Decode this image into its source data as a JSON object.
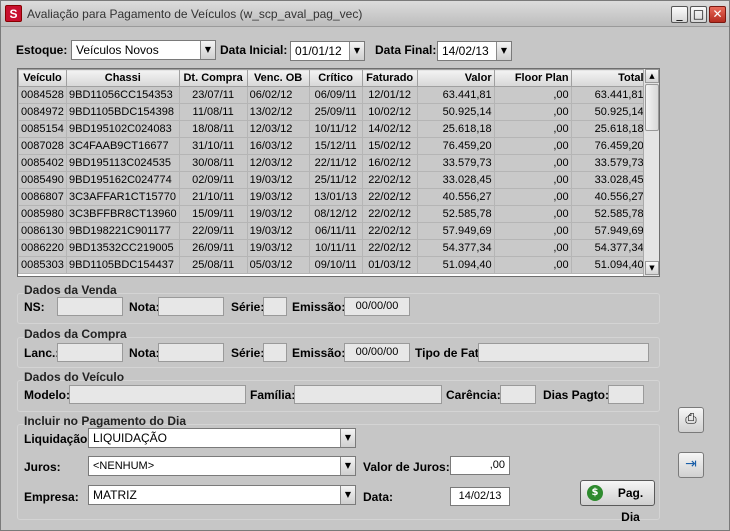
{
  "window": {
    "title": "Avaliação para Pagamento de Veículos (w_scp_aval_pag_vec)",
    "app_icon": "S"
  },
  "filters": {
    "estoque_label": "Estoque:",
    "estoque_value": "Veículos Novos",
    "data_inicial_label": "Data Inicial:",
    "data_inicial_value": "01/01/12",
    "data_final_label": "Data Final:",
    "data_final_value": "14/02/13"
  },
  "grid": {
    "columns": [
      "Veículo",
      "Chassi",
      "Dt. Compra",
      "Venc. OB",
      "Crítico",
      "Faturado",
      "Valor",
      "Floor Plan",
      "Total"
    ],
    "rows": [
      [
        "0084528",
        "9BD11056CC154353",
        "23/07/11",
        "06/02/12",
        "06/09/11",
        "12/01/12",
        "63.441,81",
        ",00",
        "63.441,81"
      ],
      [
        "0084972",
        "9BD1105BDC154398",
        "11/08/11",
        "13/02/12",
        "25/09/11",
        "10/02/12",
        "50.925,14",
        ",00",
        "50.925,14"
      ],
      [
        "0085154",
        "9BD195102C024083",
        "18/08/11",
        "12/03/12",
        "10/11/12",
        "14/02/12",
        "25.618,18",
        ",00",
        "25.618,18"
      ],
      [
        "0087028",
        "3C4FAAB9CT16677",
        "31/10/11",
        "16/03/12",
        "15/12/11",
        "15/02/12",
        "76.459,20",
        ",00",
        "76.459,20"
      ],
      [
        "0085402",
        "9BD195113C024535",
        "30/08/11",
        "12/03/12",
        "22/11/12",
        "16/02/12",
        "33.579,73",
        ",00",
        "33.579,73"
      ],
      [
        "0085490",
        "9BD195162C024774",
        "02/09/11",
        "19/03/12",
        "25/11/12",
        "22/02/12",
        "33.028,45",
        ",00",
        "33.028,45"
      ],
      [
        "0086807",
        "3C3AFFAR1CT15770",
        "21/10/11",
        "19/03/12",
        "13/01/13",
        "22/02/12",
        "40.556,27",
        ",00",
        "40.556,27"
      ],
      [
        "0085980",
        "3C3BFFBR8CT13960",
        "15/09/11",
        "19/03/12",
        "08/12/12",
        "22/02/12",
        "52.585,78",
        ",00",
        "52.585,78"
      ],
      [
        "0086130",
        "9BD198221C901177",
        "22/09/11",
        "19/03/12",
        "06/11/11",
        "22/02/12",
        "57.949,69",
        ",00",
        "57.949,69"
      ],
      [
        "0086220",
        "9BD13532CC219005",
        "26/09/11",
        "19/03/12",
        "10/11/11",
        "22/02/12",
        "54.377,34",
        ",00",
        "54.377,34"
      ],
      [
        "0085303",
        "9BD1105BDC154437",
        "25/08/11",
        "05/03/12",
        "09/10/11",
        "01/03/12",
        "51.094,40",
        ",00",
        "51.094,40"
      ]
    ]
  },
  "venda": {
    "title": "Dados da Venda",
    "ns_label": "NS:",
    "nota_label": "Nota:",
    "serie_label": "Série:",
    "emissao_label": "Emissão:",
    "emissao_value": "00/00/00"
  },
  "compra": {
    "title": "Dados da Compra",
    "lanc_label": "Lanc.:",
    "nota_label": "Nota:",
    "serie_label": "Série:",
    "emissao_label": "Emissão:",
    "emissao_value": "00/00/00",
    "tipo_fat_label": "Tipo de Fat:"
  },
  "veiculo": {
    "title": "Dados do Veículo",
    "modelo_label": "Modelo:",
    "familia_label": "Família:",
    "carencia_label": "Carência:",
    "dias_pagto_label": "Dias Pagto:"
  },
  "pagamento": {
    "title": "Incluir no Pagamento do Dia",
    "liquidacao_label": "Liquidação:",
    "liquidacao_value": "LIQUIDAÇÃO",
    "juros_label": "Juros:",
    "juros_value": "<NENHUM>",
    "valor_juros_label": "Valor de Juros:",
    "valor_juros_value": ",00",
    "empresa_label": "Empresa:",
    "empresa_value": "MATRIZ",
    "data_label": "Data:",
    "data_value": "14/02/13",
    "pag_dia_label": "Pag. Dia"
  },
  "icons": {
    "print": "printer-icon",
    "exit": "exit-door-icon",
    "pag": "money-icon"
  }
}
